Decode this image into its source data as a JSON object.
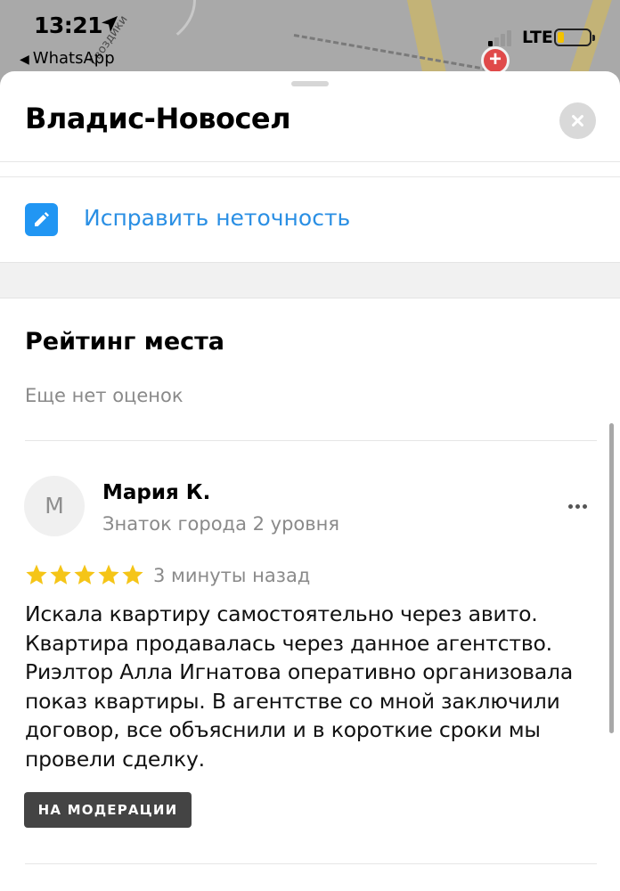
{
  "status_bar": {
    "time": "13:21",
    "back_app": "WhatsApp",
    "network": "LTE",
    "battery_color": "#f3c200"
  },
  "map": {
    "road_label": "Гвоздики",
    "pin_icon": "medical-cross-icon"
  },
  "sheet": {
    "title": "Владис-Новосел",
    "fix_label": "Исправить неточность",
    "fix_icon": "pencil-icon",
    "accent_color": "#2a8fe4"
  },
  "rating": {
    "title": "Рейтинг места",
    "empty_text": "Еще нет оценок"
  },
  "review": {
    "avatar_letter": "М",
    "author": "Мария К.",
    "level": "Знаток города 2 уровня",
    "stars": 5,
    "star_color": "#f5c518",
    "time_ago": "3 минуты назад",
    "text": "Искала квартиру самостоятельно через авито.\nКвартира продавалась через данное агентство.\nРиэлтор Алла Игнатова оперативно организовала\nпоказ квартиры. В агентстве со мной заключили\nдоговор, все объяснили и в короткие сроки  мы\nпровели сделку.",
    "moderation_badge": "НА МОДЕРАЦИИ"
  }
}
